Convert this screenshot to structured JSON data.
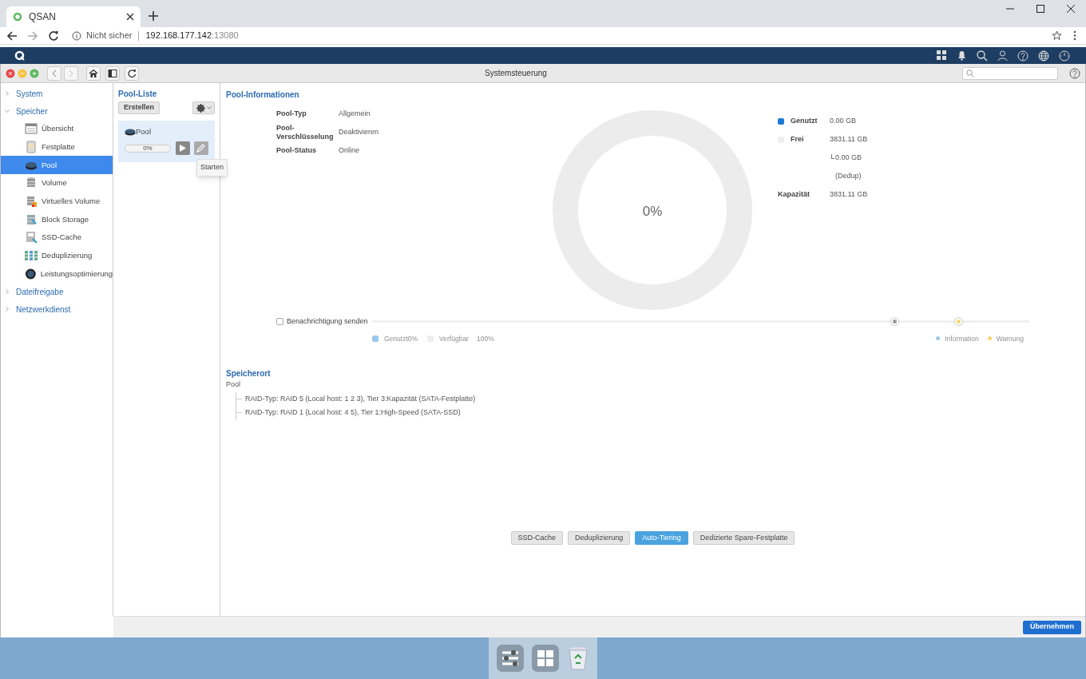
{
  "browser": {
    "tab_title": "QSAN",
    "security": "Nicht sicher",
    "host": "192.168.177.142",
    "port": ":13080"
  },
  "window": {
    "title": "Systemsteuerung"
  },
  "sidebar": {
    "items": [
      {
        "label": "System",
        "expanded": false
      },
      {
        "label": "Speicher",
        "expanded": true,
        "children": [
          {
            "label": "Übersicht",
            "selected": false
          },
          {
            "label": "Festplatte",
            "selected": false
          },
          {
            "label": "Pool",
            "selected": true
          },
          {
            "label": "Volume",
            "selected": false
          },
          {
            "label": "Virtuelles Volume",
            "selected": false
          },
          {
            "label": "Block Storage",
            "selected": false
          },
          {
            "label": "SSD-Cache",
            "selected": false
          },
          {
            "label": "Deduplizierung",
            "selected": false
          },
          {
            "label": "Leistungsoptimierung",
            "selected": false
          }
        ]
      },
      {
        "label": "Dateifreigabe",
        "expanded": false
      },
      {
        "label": "Netzwerkdienst",
        "expanded": false
      }
    ]
  },
  "pool_list": {
    "title": "Pool-Liste",
    "create_button": "Erstellen",
    "pools": [
      {
        "name": "Pool",
        "selected": true,
        "level": 0,
        "reading": "0%"
      }
    ],
    "tooltip": "Starten"
  },
  "pool_info": {
    "title": "Pool-Informationen",
    "fields": [
      {
        "label": "Pool-Typ",
        "value": "Allgemein"
      },
      {
        "label": "Pool-\nVerschlüsselung",
        "value": "Deaktivieren"
      },
      {
        "label": "Pool-Status",
        "value": "Online"
      }
    ],
    "usage_reading": "0%",
    "legend": [
      {
        "label": "Genutzt",
        "value": "0.00 GB",
        "color": "#1a7bd6"
      },
      {
        "label": "Frei",
        "value": "3831.11 GB",
        "color": "#eeeeee"
      }
    ],
    "dedup_value": "0.00 GB",
    "dedup_label": "(Dedup)",
    "capacity": {
      "label": "Kapazität",
      "value": "3831.11 GB"
    }
  },
  "notification": {
    "label": "Benachrichtigung senden",
    "checked": false,
    "thresholds": [
      {
        "level": 0.795,
        "color": "#999999"
      },
      {
        "level": 0.893,
        "color": "#f5d76e"
      }
    ],
    "usage_legend": [
      {
        "label": "Genutzt",
        "value": "0%",
        "color": "#9cc8ec"
      },
      {
        "label": "Verfügbar",
        "value": "100%",
        "color": "#eeeeee"
      }
    ],
    "threshold_legend": [
      {
        "label": "Information",
        "color": "#9cc8ec"
      },
      {
        "label": "Warnung",
        "color": "#f5d76e"
      }
    ]
  },
  "location": {
    "title": "Speicherort",
    "root": "Pool",
    "children": [
      "RAID-Typ: RAID 5 (Local host: 1 2 3), Tier 3:Kapazität (SATA-Festplatte)",
      "RAID-Typ: RAID 1 (Local host: 4 5), Tier 1:High-Speed (SATA-SSD)"
    ]
  },
  "feature_tabs": [
    {
      "label": "SSD-Cache",
      "selected": false
    },
    {
      "label": "Deduplizierung",
      "selected": false
    },
    {
      "label": "Auto-Tiering",
      "selected": true
    },
    {
      "label": "Dedizierte Spare-Festplatte",
      "selected": false
    }
  ],
  "apply_button": "Übernehmen"
}
